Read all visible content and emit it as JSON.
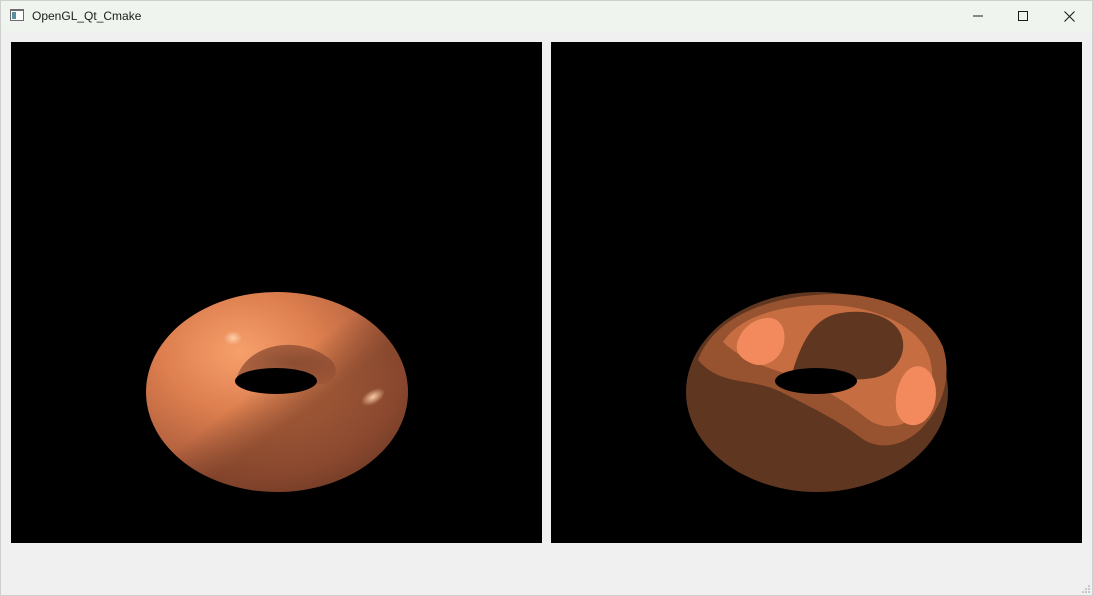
{
  "window": {
    "title": "OpenGL_Qt_Cmake",
    "icon": "app-window-icon",
    "controls": [
      "minimize-icon",
      "maximize-icon",
      "close-icon"
    ]
  },
  "views": [
    {
      "name": "smooth-shaded-torus-view",
      "shading": "smooth",
      "background": "#000000",
      "object_color": "#e7864f"
    },
    {
      "name": "toon-shaded-torus-view",
      "shading": "toon",
      "background": "#000000",
      "bands": [
        "#5f361f",
        "#97522f",
        "#c76d42",
        "#f38a5d"
      ]
    }
  ],
  "status": {
    "text": ""
  }
}
